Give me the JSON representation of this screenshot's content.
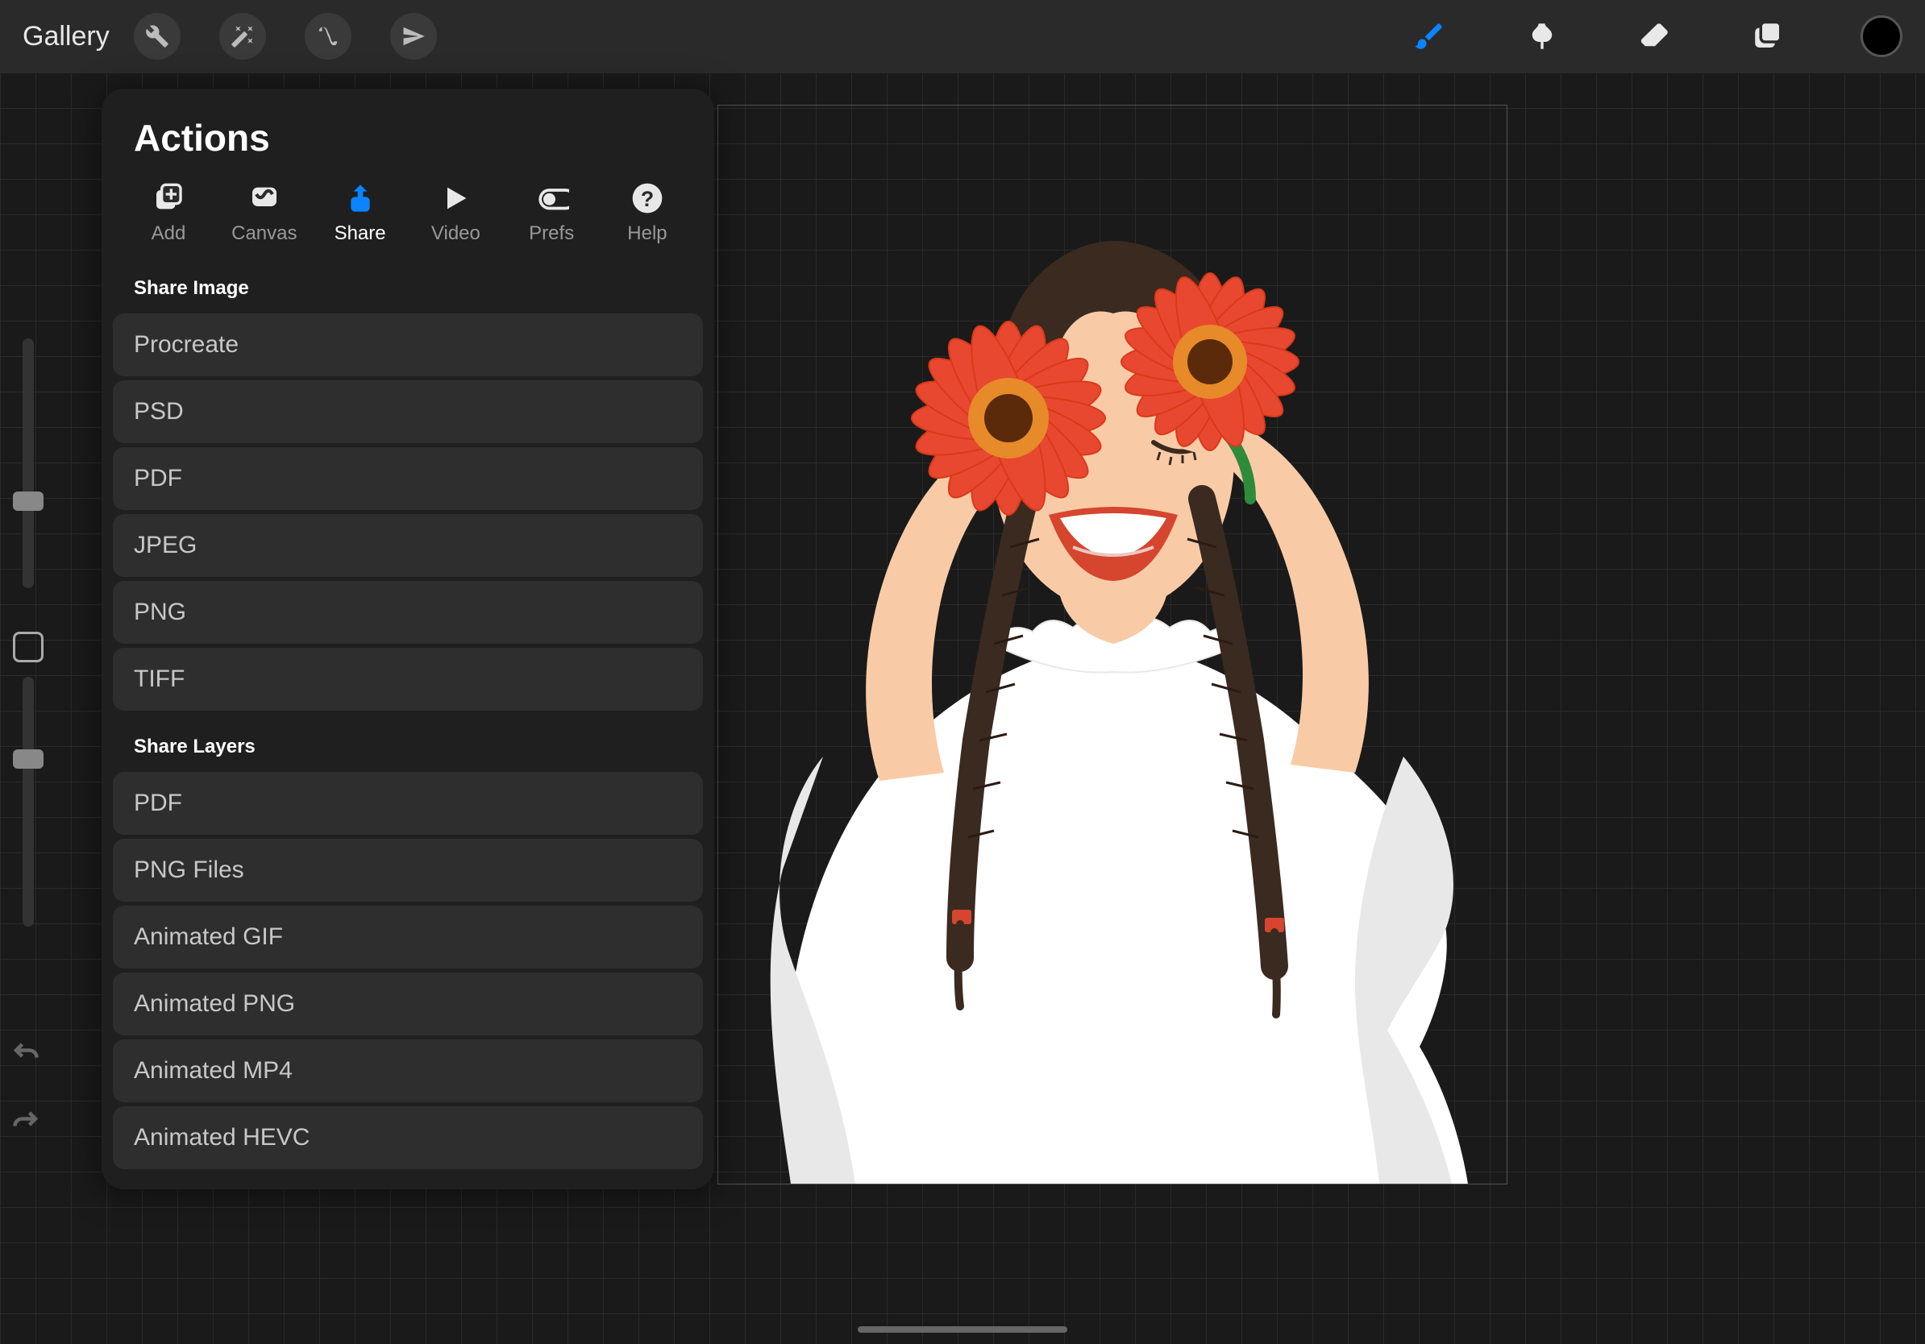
{
  "topbar": {
    "gallery": "Gallery"
  },
  "popover": {
    "title": "Actions",
    "tabs": [
      {
        "label": "Add"
      },
      {
        "label": "Canvas"
      },
      {
        "label": "Share"
      },
      {
        "label": "Video"
      },
      {
        "label": "Prefs"
      },
      {
        "label": "Help"
      }
    ],
    "section1": "Share Image",
    "image_options": [
      "Procreate",
      "PSD",
      "PDF",
      "JPEG",
      "PNG",
      "TIFF"
    ],
    "section2": "Share Layers",
    "layer_options": [
      "PDF",
      "PNG Files",
      "Animated GIF",
      "Animated PNG",
      "Animated MP4",
      "Animated HEVC"
    ]
  },
  "colors": {
    "accent": "#0a84ff",
    "flower": "#e8482f",
    "flower_center": "#d9391a",
    "flower_core_dark": "#5a2a0a",
    "flower_core_ring": "#e78a2a",
    "skin": "#f8cba6",
    "hair": "#3b2a20",
    "lips": "#d6452e",
    "shirt": "#ffffff",
    "shirt_shadow": "#e8e8e8",
    "stem": "#2e8b3a"
  }
}
